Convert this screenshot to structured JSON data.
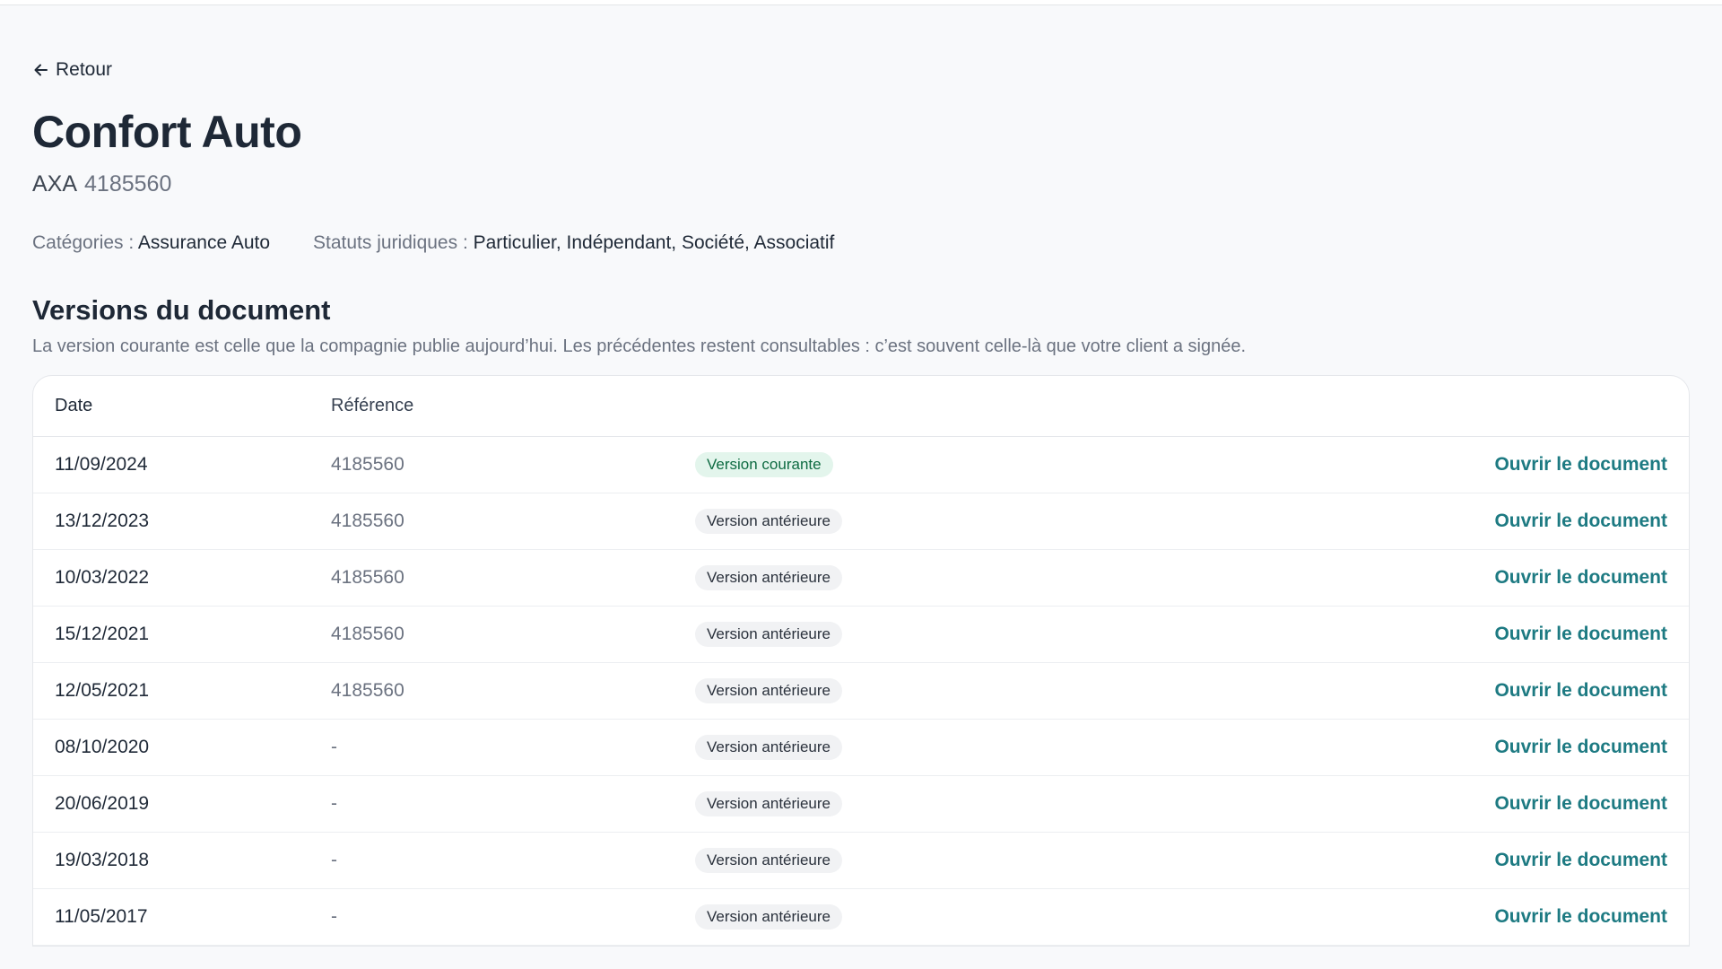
{
  "nav": {
    "back_label": "Retour"
  },
  "product": {
    "title": "Confort Auto",
    "insurer": "AXA",
    "reference": "4185560"
  },
  "meta": {
    "categories_label": "Catégories :",
    "categories_value": "Assurance Auto",
    "statuts_label": "Statuts juridiques :",
    "statuts_value": "Particulier, Indépendant, Société, Associatif"
  },
  "versions": {
    "title": "Versions du document",
    "description": "La version courante est celle que la compagnie publie aujourd’hui. Les précédentes restent consultables : c’est souvent celle-là que votre client a signée.",
    "columns": {
      "date": "Date",
      "reference": "Référence"
    },
    "rows": [
      {
        "date": "11/09/2024",
        "reference": "4185560",
        "status": "Version courante",
        "current": true,
        "action": "Ouvrir le document"
      },
      {
        "date": "13/12/2023",
        "reference": "4185560",
        "status": "Version antérieure",
        "current": false,
        "action": "Ouvrir le document"
      },
      {
        "date": "10/03/2022",
        "reference": "4185560",
        "status": "Version antérieure",
        "current": false,
        "action": "Ouvrir le document"
      },
      {
        "date": "15/12/2021",
        "reference": "4185560",
        "status": "Version antérieure",
        "current": false,
        "action": "Ouvrir le document"
      },
      {
        "date": "12/05/2021",
        "reference": "4185560",
        "status": "Version antérieure",
        "current": false,
        "action": "Ouvrir le document"
      },
      {
        "date": "08/10/2020",
        "reference": "-",
        "status": "Version antérieure",
        "current": false,
        "action": "Ouvrir le document"
      },
      {
        "date": "20/06/2019",
        "reference": "-",
        "status": "Version antérieure",
        "current": false,
        "action": "Ouvrir le document"
      },
      {
        "date": "19/03/2018",
        "reference": "-",
        "status": "Version antérieure",
        "current": false,
        "action": "Ouvrir le document"
      },
      {
        "date": "11/05/2017",
        "reference": "-",
        "status": "Version antérieure",
        "current": false,
        "action": "Ouvrir le document"
      }
    ]
  },
  "colors": {
    "link": "#1d7a82",
    "badge_current_bg": "#e3f5ec",
    "badge_current_text": "#0e6b42",
    "badge_past_bg": "#f1f2f4"
  }
}
